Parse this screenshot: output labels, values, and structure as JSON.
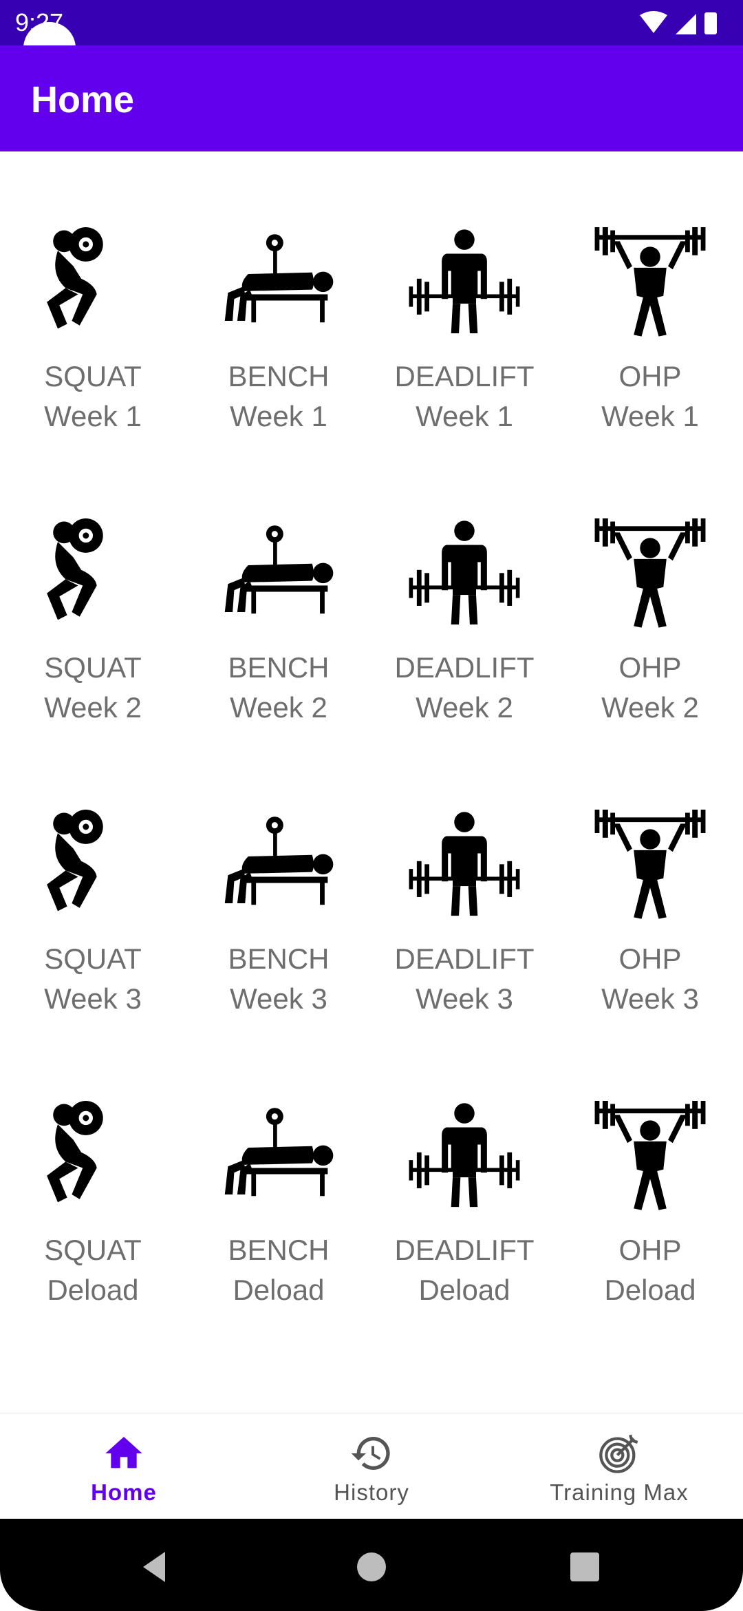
{
  "status_bar": {
    "time": "9:27"
  },
  "app_bar": {
    "title": "Home"
  },
  "tiles": [
    {
      "lift": "SQUAT",
      "week": "Week 1",
      "icon": "squat-icon"
    },
    {
      "lift": "BENCH",
      "week": "Week 1",
      "icon": "bench-press-icon"
    },
    {
      "lift": "DEADLIFT",
      "week": "Week 1",
      "icon": "deadlift-icon"
    },
    {
      "lift": "OHP",
      "week": "Week 1",
      "icon": "overhead-press-icon"
    },
    {
      "lift": "SQUAT",
      "week": "Week 2",
      "icon": "squat-icon"
    },
    {
      "lift": "BENCH",
      "week": "Week 2",
      "icon": "bench-press-icon"
    },
    {
      "lift": "DEADLIFT",
      "week": "Week 2",
      "icon": "deadlift-icon"
    },
    {
      "lift": "OHP",
      "week": "Week 2",
      "icon": "overhead-press-icon"
    },
    {
      "lift": "SQUAT",
      "week": "Week 3",
      "icon": "squat-icon"
    },
    {
      "lift": "BENCH",
      "week": "Week 3",
      "icon": "bench-press-icon"
    },
    {
      "lift": "DEADLIFT",
      "week": "Week 3",
      "icon": "deadlift-icon"
    },
    {
      "lift": "OHP",
      "week": "Week 3",
      "icon": "overhead-press-icon"
    },
    {
      "lift": "SQUAT",
      "week": "Deload",
      "icon": "squat-icon"
    },
    {
      "lift": "BENCH",
      "week": "Deload",
      "icon": "bench-press-icon"
    },
    {
      "lift": "DEADLIFT",
      "week": "Deload",
      "icon": "deadlift-icon"
    },
    {
      "lift": "OHP",
      "week": "Deload",
      "icon": "overhead-press-icon"
    }
  ],
  "bottom_nav": {
    "items": [
      {
        "label": "Home",
        "icon": "home-icon",
        "active": true
      },
      {
        "label": "History",
        "icon": "history-icon",
        "active": false
      },
      {
        "label": "Training Max",
        "icon": "target-icon",
        "active": false
      }
    ]
  },
  "colors": {
    "primary": "#6200ee",
    "primary_dark": "#3700b3",
    "label": "#6e6e6e"
  }
}
